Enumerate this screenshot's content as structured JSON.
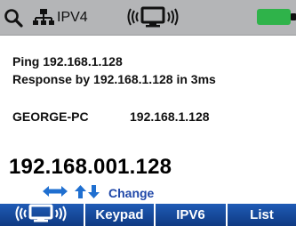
{
  "status_bar": {
    "protocol": "IPV4",
    "icons": [
      "search-icon",
      "network-icon",
      "wifi-icon",
      "battery-icon"
    ],
    "battery_color": "#2fb34a"
  },
  "results": {
    "ping_line": "Ping 192.168.1.128",
    "response_line": "Response by 192.168.1.128 in 3ms",
    "host_name": "GEORGE-PC",
    "host_ip": "192.168.1.128"
  },
  "entry": {
    "ip_value": "192.168.001.128"
  },
  "navigation": {
    "arrows": [
      "left-arrow",
      "right-arrow",
      "up-arrow",
      "down-arrow"
    ],
    "change_label": "Change",
    "arrow_color": "#1f6fd0"
  },
  "softkeys": {
    "wifi_icon": "wifi-icon",
    "keypad": "Keypad",
    "ipv6": "IPV6",
    "list": "List",
    "background_color": "#1a4fa3"
  }
}
